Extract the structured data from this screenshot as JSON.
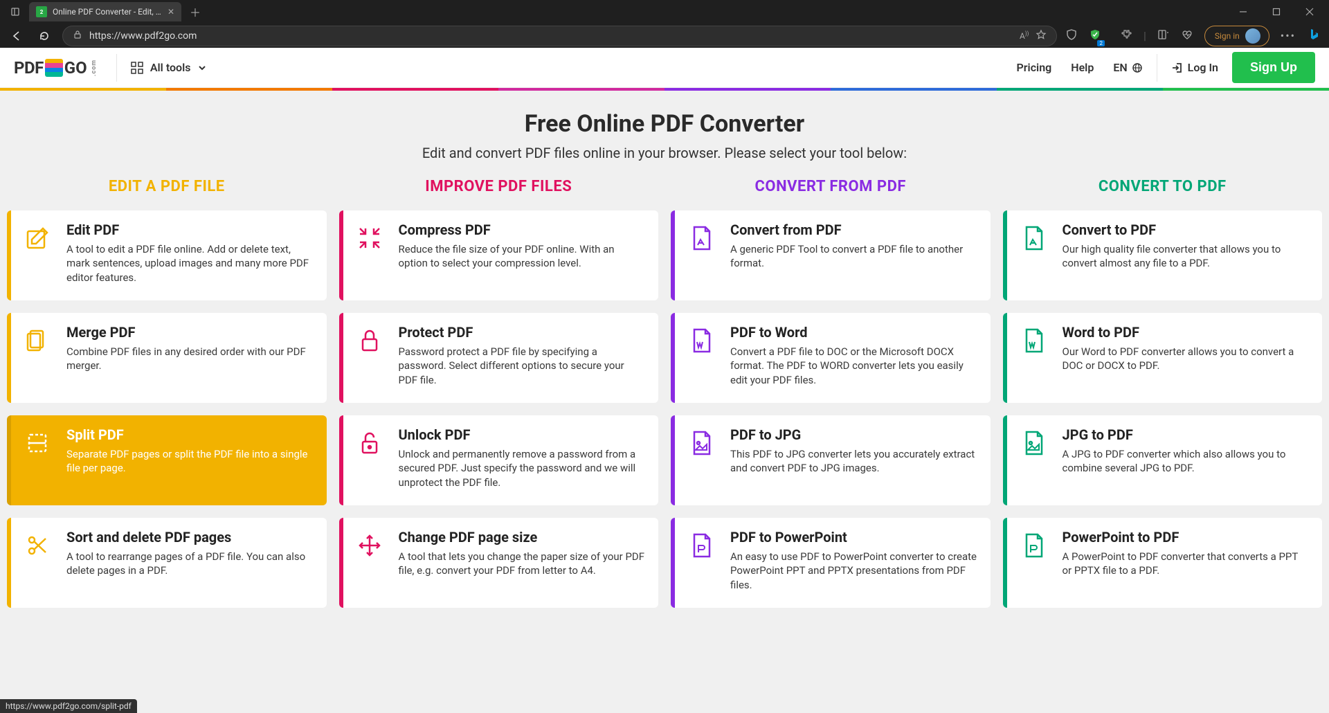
{
  "browser": {
    "tab_title": "Online PDF Converter - Edit, rota",
    "url": "https://www.pdf2go.com",
    "signin": "Sign in",
    "status_url": "https://www.pdf2go.com/split-pdf"
  },
  "header": {
    "logo_pre": "PDF",
    "logo_post": "GO",
    "logo_suffix": ".com",
    "all_tools": "All tools",
    "pricing": "Pricing",
    "help": "Help",
    "lang": "EN",
    "login": "Log In",
    "signup": "Sign Up"
  },
  "hero": {
    "title": "Free Online PDF Converter",
    "subtitle": "Edit and convert PDF files online in your browser. Please select your tool below:"
  },
  "columns": [
    {
      "label": "EDIT A PDF FILE"
    },
    {
      "label": "IMPROVE PDF FILES"
    },
    {
      "label": "CONVERT FROM PDF"
    },
    {
      "label": "CONVERT TO PDF"
    }
  ],
  "cards": {
    "edit_pdf": {
      "title": "Edit PDF",
      "desc": "A tool to edit a PDF file online. Add or delete text, mark sentences, upload images and many more PDF editor features."
    },
    "merge_pdf": {
      "title": "Merge PDF",
      "desc": "Combine PDF files in any desired order with our PDF merger."
    },
    "split_pdf": {
      "title": "Split PDF",
      "desc": "Separate PDF pages or split the PDF file into a single file per page."
    },
    "sort_pdf": {
      "title": "Sort and delete PDF pages",
      "desc": "A tool to rearrange pages of a PDF file. You can also delete pages in a PDF."
    },
    "compress_pdf": {
      "title": "Compress PDF",
      "desc": "Reduce the file size of your PDF online. With an option to select your compression level."
    },
    "protect_pdf": {
      "title": "Protect PDF",
      "desc": "Password protect a PDF file by specifying a password. Select different options to secure your PDF file."
    },
    "unlock_pdf": {
      "title": "Unlock PDF",
      "desc": "Unlock and permanently remove a password from a secured PDF. Just specify the password and we will unprotect the PDF file."
    },
    "change_size": {
      "title": "Change PDF page size",
      "desc": "A tool that lets you change the paper size of your PDF file, e.g. convert your PDF from letter to A4."
    },
    "convert_from": {
      "title": "Convert from PDF",
      "desc": "A generic PDF Tool to convert a PDF file to another format."
    },
    "pdf_to_word": {
      "title": "PDF to Word",
      "desc": "Convert a PDF file to DOC or the Microsoft DOCX format. The PDF to WORD converter lets you easily edit your PDF files."
    },
    "pdf_to_jpg": {
      "title": "PDF to JPG",
      "desc": "This PDF to JPG converter lets you accurately extract and convert PDF to JPG images."
    },
    "pdf_to_ppt": {
      "title": "PDF to PowerPoint",
      "desc": "An easy to use PDF to PowerPoint converter to create PowerPoint PPT and PPTX presentations from PDF files."
    },
    "convert_to": {
      "title": "Convert to PDF",
      "desc": "Our high quality file converter that allows you to convert almost any file to a PDF."
    },
    "word_to_pdf": {
      "title": "Word to PDF",
      "desc": "Our Word to PDF converter allows you to convert a DOC or DOCX to PDF."
    },
    "jpg_to_pdf": {
      "title": "JPG to PDF",
      "desc": "A JPG to PDF converter which also allows you to combine several JPG to PDF."
    },
    "ppt_to_pdf": {
      "title": "PowerPoint to PDF",
      "desc": "A PowerPoint to PDF converter that converts a PPT or PPTX file to a PDF."
    }
  }
}
